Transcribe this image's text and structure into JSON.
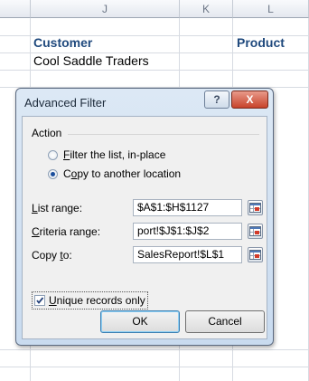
{
  "sheet": {
    "columns": [
      "J",
      "K",
      "L"
    ],
    "cells": {
      "j1": "Customer",
      "l1": "Product",
      "j2": "Cool Saddle Traders"
    }
  },
  "dialog": {
    "title": "Advanced Filter",
    "help_label": "?",
    "close_label": "X",
    "action_label": "Action",
    "radio_filter": {
      "label_pre": "",
      "label_key": "F",
      "label_post": "ilter the list, in-place",
      "checked": false
    },
    "radio_copy": {
      "label_pre": "C",
      "label_key": "o",
      "label_post": "py to another location",
      "checked": true
    },
    "list_range": {
      "label_key": "L",
      "label_post": "ist range:",
      "value": "$A$1:$H$1127"
    },
    "criteria_range": {
      "label_key": "C",
      "label_post": "riteria range:",
      "value": "port!$J$1:$J$2"
    },
    "copy_to": {
      "label_pre": "Copy ",
      "label_key": "t",
      "label_post": "o:",
      "value": "SalesReport!$L$1"
    },
    "unique": {
      "label_key": "U",
      "label_post": "nique records only",
      "checked": true
    },
    "ok_label": "OK",
    "cancel_label": "Cancel"
  },
  "colors": {
    "header_text": "#1f497d",
    "title_bar": "#c9dbef",
    "close_button": "#c8432b"
  }
}
